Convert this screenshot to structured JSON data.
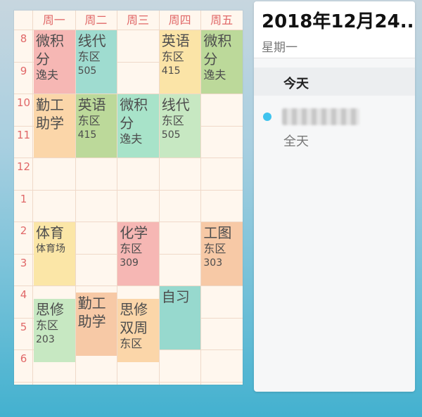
{
  "timetable": {
    "days": [
      "周一",
      "周二",
      "周三",
      "周四",
      "周五"
    ],
    "hours": [
      "8",
      "9",
      "10",
      "11",
      "12",
      "1",
      "2",
      "3",
      "4",
      "5",
      "6"
    ],
    "courses": [
      {
        "day": 0,
        "slot": 0,
        "span": 2,
        "name": "微积分",
        "lines": [
          "逸夫"
        ],
        "color": "#f6b7b4"
      },
      {
        "day": 1,
        "slot": 0,
        "span": 2,
        "name": "线代",
        "lines": [
          "东区",
          "505"
        ],
        "color": "#9fdcd0"
      },
      {
        "day": 3,
        "slot": 0,
        "span": 2,
        "name": "英语",
        "lines": [
          "东区",
          "415"
        ],
        "color": "#fbe4a7"
      },
      {
        "day": 4,
        "slot": 0,
        "span": 2,
        "name": "微积分",
        "lines": [
          "逸夫"
        ],
        "color": "#bcd99a"
      },
      {
        "day": 0,
        "slot": 2,
        "span": 2,
        "name": "勤工助学",
        "lines": [],
        "color": "#fbd6a9"
      },
      {
        "day": 1,
        "slot": 2,
        "span": 2,
        "name": "英语",
        "lines": [
          "东区",
          "415"
        ],
        "color": "#bcd99a"
      },
      {
        "day": 2,
        "slot": 2,
        "span": 2,
        "name": "微积分",
        "lines": [
          "逸夫"
        ],
        "color": "#a8e3c9"
      },
      {
        "day": 3,
        "slot": 2,
        "span": 2,
        "name": "线代",
        "lines": [
          "东区",
          "505"
        ],
        "color": "#c7e8c2"
      },
      {
        "day": 0,
        "slot": 6,
        "span": 2,
        "name": "体育",
        "lines": [
          "体育场"
        ],
        "color": "#fbe6a7"
      },
      {
        "day": 2,
        "slot": 6,
        "span": 2,
        "name": "化学",
        "lines": [
          "东区",
          "309"
        ],
        "color": "#f6b7b4"
      },
      {
        "day": 4,
        "slot": 6,
        "span": 2,
        "name": "工图",
        "lines": [
          "东区",
          "303"
        ],
        "color": "#f7c9a6"
      },
      {
        "day": 3,
        "slot": 8,
        "span": 2,
        "name": "自习",
        "lines": [],
        "color": "#97d9ce"
      },
      {
        "day": 0,
        "slot": 8.4,
        "span": 2,
        "name": "思修",
        "lines": [
          "东区",
          "203"
        ],
        "color": "#c7e8c2"
      },
      {
        "day": 1,
        "slot": 8.2,
        "span": 2,
        "name": "勤工助学",
        "lines": [],
        "color": "#f7c9a6"
      },
      {
        "day": 2,
        "slot": 8.4,
        "span": 2,
        "name": "思修双周",
        "lines": [
          "东区"
        ],
        "color": "#fbd6a9"
      }
    ]
  },
  "calendar": {
    "date": "2018年12月24...",
    "weekday": "星期一",
    "today_label": "今天",
    "event_title": "",
    "event_time": "全天",
    "event_color": "#3fc3ee"
  }
}
